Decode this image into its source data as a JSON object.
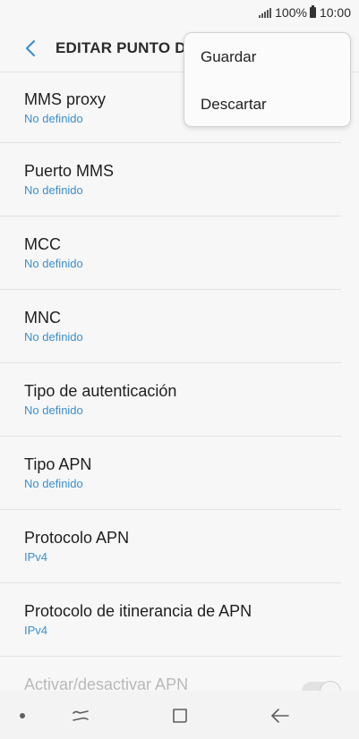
{
  "status_bar": {
    "battery_percent": "100%",
    "time": "10:00"
  },
  "app_bar": {
    "title": "EDITAR PUNTO DE ACCESO"
  },
  "menu": {
    "items": [
      {
        "label": "Guardar"
      },
      {
        "label": "Descartar"
      }
    ]
  },
  "settings": [
    {
      "title": "MMS proxy",
      "value": "No definido"
    },
    {
      "title": "Puerto MMS",
      "value": "No definido"
    },
    {
      "title": "MCC",
      "value": "No definido"
    },
    {
      "title": "MNC",
      "value": "No definido"
    },
    {
      "title": "Tipo de autenticación",
      "value": "No definido"
    },
    {
      "title": "Tipo APN",
      "value": "No definido"
    },
    {
      "title": "Protocolo APN",
      "value": "IPv4"
    },
    {
      "title": "Protocolo de itinerancia de APN",
      "value": "IPv4"
    }
  ],
  "toggle_setting": {
    "title": "Activar/desactivar APN",
    "enabled": true
  },
  "colors": {
    "accent": "#3b8fd0",
    "background": "#f7f7f7"
  },
  "icons": {
    "back": "chevron-left-icon",
    "signal": "signal-icon",
    "battery": "battery-icon",
    "recents": "recents-icon",
    "home": "home-icon",
    "nav_back": "back-arrow-icon"
  }
}
